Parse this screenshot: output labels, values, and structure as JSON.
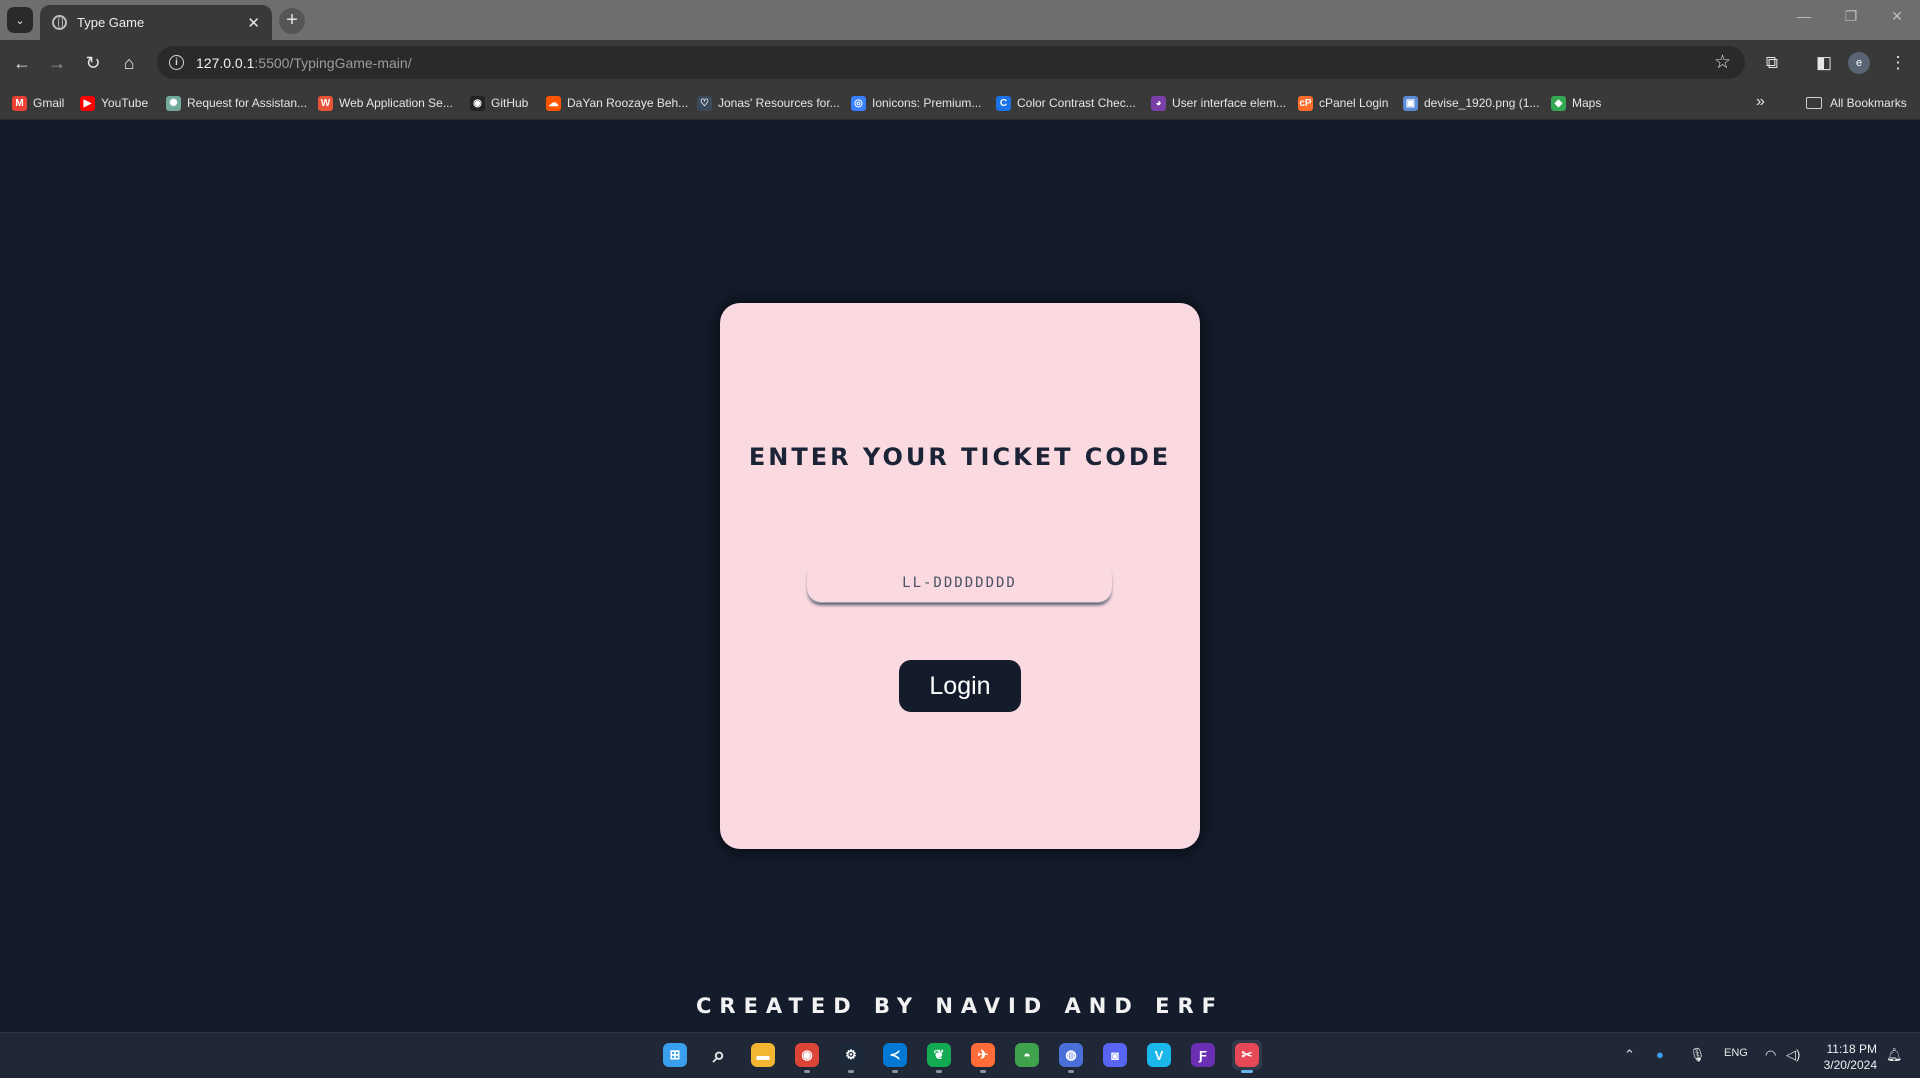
{
  "browser": {
    "tab_title": "Type Game",
    "tab_close": "✕",
    "new_tab": "+",
    "tab_list": "⌄",
    "url_host": "127.0.0.1",
    "url_path": ":5500/TypingGame-main/",
    "profile_initial": "e"
  },
  "bookmarks": [
    {
      "label": "Gmail",
      "icon": "gmail-icon",
      "color": "#ea4335",
      "glyph": "M"
    },
    {
      "label": "YouTube",
      "icon": "youtube-icon",
      "color": "#ff0000",
      "glyph": "▶"
    },
    {
      "label": "Request for Assistan...",
      "icon": "chatgpt-icon",
      "color": "#74aa9c",
      "glyph": "✺"
    },
    {
      "label": "Web Application Se...",
      "icon": "app-icon",
      "color": "#e8543a",
      "glyph": "W"
    },
    {
      "label": "GitHub",
      "icon": "github-icon",
      "color": "#222222",
      "glyph": "◉"
    },
    {
      "label": "DaYan Roozaye Beh...",
      "icon": "soundcloud-icon",
      "color": "#ff5500",
      "glyph": "☁"
    },
    {
      "label": "Jonas' Resources for...",
      "icon": "heart-icon",
      "color": "#3a4a5a",
      "glyph": "♡"
    },
    {
      "label": "Ionicons: Premium...",
      "icon": "ionicons-icon",
      "color": "#3880ff",
      "glyph": "◎"
    },
    {
      "label": "Color Contrast Chec...",
      "icon": "contrast-icon",
      "color": "#1a73e8",
      "glyph": "C"
    },
    {
      "label": "User interface elem...",
      "icon": "ui-icon",
      "color": "#7b3fa8",
      "glyph": "◕"
    },
    {
      "label": "cPanel Login",
      "icon": "cpanel-icon",
      "color": "#ff6c2c",
      "glyph": "cP"
    },
    {
      "label": "devise_1920.png (1...",
      "icon": "image-icon",
      "color": "#5b8dd6",
      "glyph": "▣"
    },
    {
      "label": "Maps",
      "icon": "maps-icon",
      "color": "#34a853",
      "glyph": "◆"
    }
  ],
  "all_bookmarks": "All Bookmarks",
  "page": {
    "title": "ENTER YOUR TICKET CODE",
    "input_placeholder": "LL-DDDDDDDD",
    "login_label": "Login",
    "footer": "CREATED BY NAVID AND ERF"
  },
  "taskbar": {
    "apps": [
      {
        "name": "windows-start",
        "color": "#3aa0ee",
        "glyph": "⊞"
      },
      {
        "name": "search",
        "color": "transparent",
        "glyph": "⌕"
      },
      {
        "name": "file-explorer",
        "color": "#f2b632",
        "glyph": "▬"
      },
      {
        "name": "chrome",
        "color": "#db4437",
        "glyph": "◉"
      },
      {
        "name": "steam",
        "color": "#1b2838",
        "glyph": "⚙"
      },
      {
        "name": "vscode",
        "color": "#0078d4",
        "glyph": "≺"
      },
      {
        "name": "mongodb-compass",
        "color": "#13aa52",
        "glyph": "❦"
      },
      {
        "name": "postman",
        "color": "#ff6c37",
        "glyph": "✈"
      },
      {
        "name": "photos",
        "color": "#3fa34d",
        "glyph": "◓"
      },
      {
        "name": "copilot",
        "color": "#4a6fd8",
        "glyph": "◍"
      },
      {
        "name": "discord",
        "color": "#5865f2",
        "glyph": "◙"
      },
      {
        "name": "vimeo",
        "color": "#1ab7ea",
        "glyph": "V"
      },
      {
        "name": "figma-app",
        "color": "#6b2fb4",
        "glyph": "Ƒ"
      },
      {
        "name": "snipping-tool",
        "color": "#e74856",
        "glyph": "✂"
      }
    ],
    "language": "ENG",
    "time": "11:18 PM",
    "date": "3/20/2024"
  }
}
